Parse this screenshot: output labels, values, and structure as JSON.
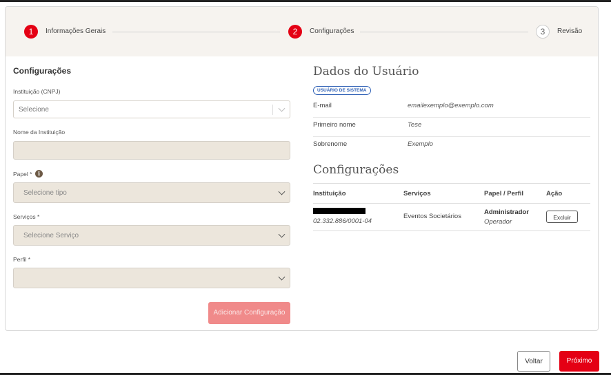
{
  "stepper": {
    "steps": [
      {
        "number": "1",
        "label": "Informações Gerais",
        "state": "active"
      },
      {
        "number": "2",
        "label": "Configurações",
        "state": "active"
      },
      {
        "number": "3",
        "label": "Revisão",
        "state": "inactive"
      }
    ]
  },
  "form": {
    "title": "Configurações",
    "instituicao_label": "Instituição (CNPJ)",
    "instituicao_placeholder": "Selecione",
    "nome_label": "Nome da Instituição",
    "nome_value": "",
    "papel_label": "Papel *",
    "papel_info_icon": "i",
    "papel_placeholder": "Selecione tipo",
    "servicos_label": "Serviços *",
    "servicos_placeholder": "Selecione Serviço",
    "perfil_label": "Perfil *",
    "perfil_placeholder": "",
    "add_button": "Adicionar Configuração"
  },
  "user": {
    "title": "Dados do Usuário",
    "badge": "USUÁRIO DE SISTEMA",
    "fields": [
      {
        "key": "E-mail",
        "value": "emailexemplo@exemplo.com"
      },
      {
        "key": "Primeiro nome",
        "value": "Tese"
      },
      {
        "key": "Sobrenome",
        "value": "Exemplo"
      }
    ]
  },
  "config_table": {
    "title": "Configurações",
    "headers": [
      "Instituição",
      "Serviços",
      "Papel / Perfil",
      "Ação"
    ],
    "rows": [
      {
        "cnpj": "02.332.886/0001-04",
        "servico": "Eventos Societários",
        "papel": "Administrador",
        "perfil": "Operador",
        "action": "Excluir"
      }
    ]
  },
  "footer": {
    "back": "Voltar",
    "next": "Próximo"
  },
  "colors": {
    "accent": "#e40014",
    "badge": "#2d5fb5",
    "disabled_button": "#f08a8a",
    "field_disabled": "#ece6dc",
    "stepper_bg": "#f6f3ef"
  }
}
